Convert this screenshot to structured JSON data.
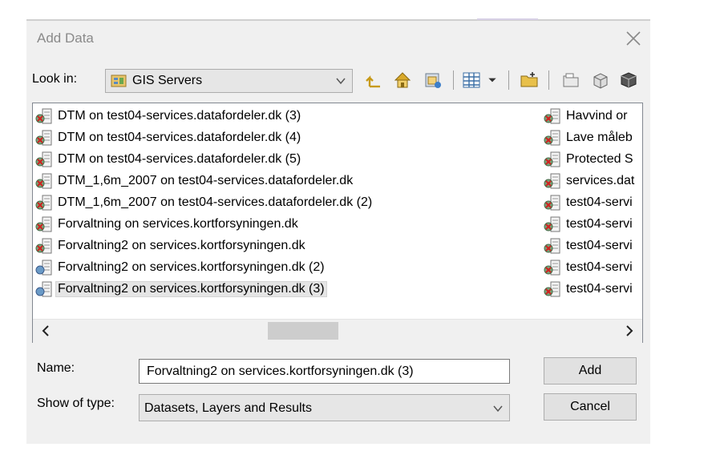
{
  "dialog": {
    "title": "Add Data"
  },
  "lookin": {
    "label": "Look in:",
    "value": "GIS Servers"
  },
  "toolbar": {
    "icons": [
      "up-one-level-icon",
      "home-icon",
      "connect-to-folder-icon",
      "view-list-icon",
      "dropdown-arrow-icon",
      "new-folder-icon",
      "new-file-geodatabase-icon",
      "new-toolbox-icon",
      "catalog-icon"
    ]
  },
  "list": {
    "left_column": [
      "DTM on test04-services.datafordeler.dk (3)",
      "DTM on test04-services.datafordeler.dk (4)",
      "DTM on test04-services.datafordeler.dk (5)",
      "DTM_1,6m_2007 on test04-services.datafordeler.dk",
      "DTM_1,6m_2007 on test04-services.datafordeler.dk (2)",
      "Forvaltning on services.kortforsyningen.dk",
      "Forvaltning2 on services.kortforsyningen.dk",
      "Forvaltning2 on services.kortforsyningen.dk (2)",
      "Forvaltning2 on services.kortforsyningen.dk (3)"
    ],
    "right_column": [
      "Havvind or",
      "Lave måleb",
      "Protected S",
      "services.dat",
      "test04-servi",
      "test04-servi",
      "test04-servi",
      "test04-servi",
      "test04-servi"
    ],
    "selected_item": "Forvaltning2 on services.kortforsyningen.dk (3)"
  },
  "scrollbar": {
    "left_arrow": "‹",
    "right_arrow": "›"
  },
  "name_field": {
    "label": "Name:",
    "value": "Forvaltning2 on services.kortforsyningen.dk (3)"
  },
  "type_field": {
    "label": "Show of type:",
    "value": "Datasets, Layers and Results"
  },
  "buttons": {
    "add": "Add",
    "cancel": "Cancel"
  }
}
